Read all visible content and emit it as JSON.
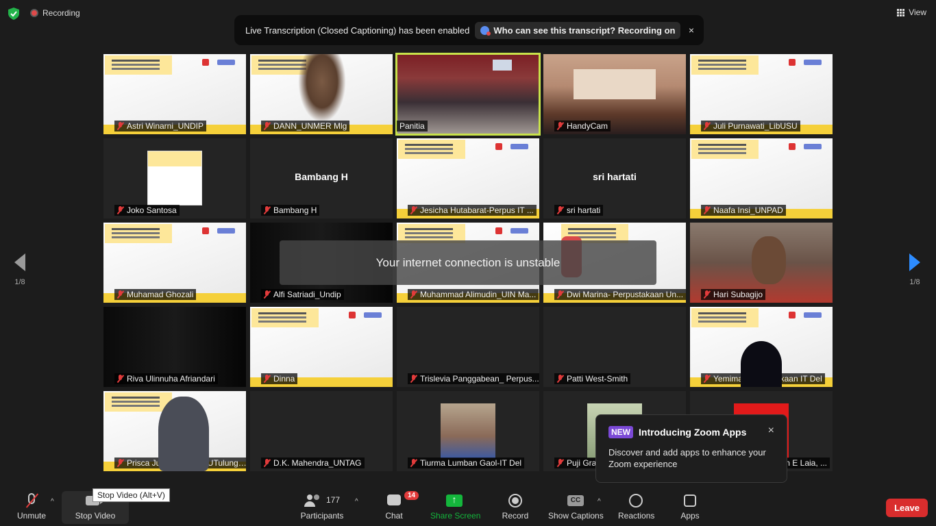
{
  "status": {
    "recording_label": "Recording",
    "view_label": "View"
  },
  "banner": {
    "text": "Live Transcription (Closed Captioning) has been enabled",
    "pill": "Who can see this transcript? Recording on",
    "close": "×"
  },
  "tiles": [
    {
      "name": "Astri Winarni_UNDIP"
    },
    {
      "name": "DANN_UNMER Mlg"
    },
    {
      "name": "Panitia"
    },
    {
      "name": "HandyCam"
    },
    {
      "name": "Juli Purnawati_LibUSU"
    },
    {
      "name": "Joko Santosa"
    },
    {
      "name": "Bambang H",
      "center": "Bambang H"
    },
    {
      "name": "Jesicha Hutabarat-Perpus IT ..."
    },
    {
      "name": "sri hartati",
      "center": "sri hartati"
    },
    {
      "name": "Naafa Insi_UNPAD"
    },
    {
      "name": "Muhamad Ghozali"
    },
    {
      "name": "Alfi Satriadi_Undip"
    },
    {
      "name": "Muhammad Alimudin_UIN Ma..."
    },
    {
      "name": "Dwi Marina- Perpustakaan Un..."
    },
    {
      "name": "Hari Subagijo"
    },
    {
      "name": "Riva Ulinnuha Afriandari"
    },
    {
      "name": "Dinna"
    },
    {
      "name": "Trislevia Panggabean_ Perpus..."
    },
    {
      "name": "Patti West-Smith"
    },
    {
      "name": "Yemima_Perpustakaan IT Del"
    },
    {
      "name": "Prisca Juvita_UINSATUTulunga..."
    },
    {
      "name": "D.K. Mahendra_UNTAG"
    },
    {
      "name": "Tiurma Lumban Gaol-IT Del"
    },
    {
      "name": "Puji Grac"
    },
    {
      "name": "n E Laia, ..."
    }
  ],
  "warning": "Your internet connection is unstable",
  "pager": {
    "left": "1/8",
    "right": "1/8"
  },
  "toast": {
    "badge": "NEW",
    "title": "Introducing Zoom Apps",
    "body": "Discover and add apps to enhance your Zoom experience",
    "close": "×"
  },
  "toolbar": {
    "unmute": "Unmute",
    "stop_video": "Stop Video",
    "tooltip": "Stop Video (Alt+V)",
    "participants_count": "177",
    "participants": "Participants",
    "chat": "Chat",
    "chat_badge": "14",
    "share": "Share Screen",
    "record": "Record",
    "cc_icon": "CC",
    "captions": "Show Captions",
    "reactions": "Reactions",
    "apps": "Apps",
    "leave": "Leave"
  },
  "colors": {
    "accent_share": "#14b63c",
    "leave": "#d92d2d",
    "active_speaker": "#c8e24a",
    "muted": "#e23b3b",
    "next_arrow": "#2d8cff"
  }
}
